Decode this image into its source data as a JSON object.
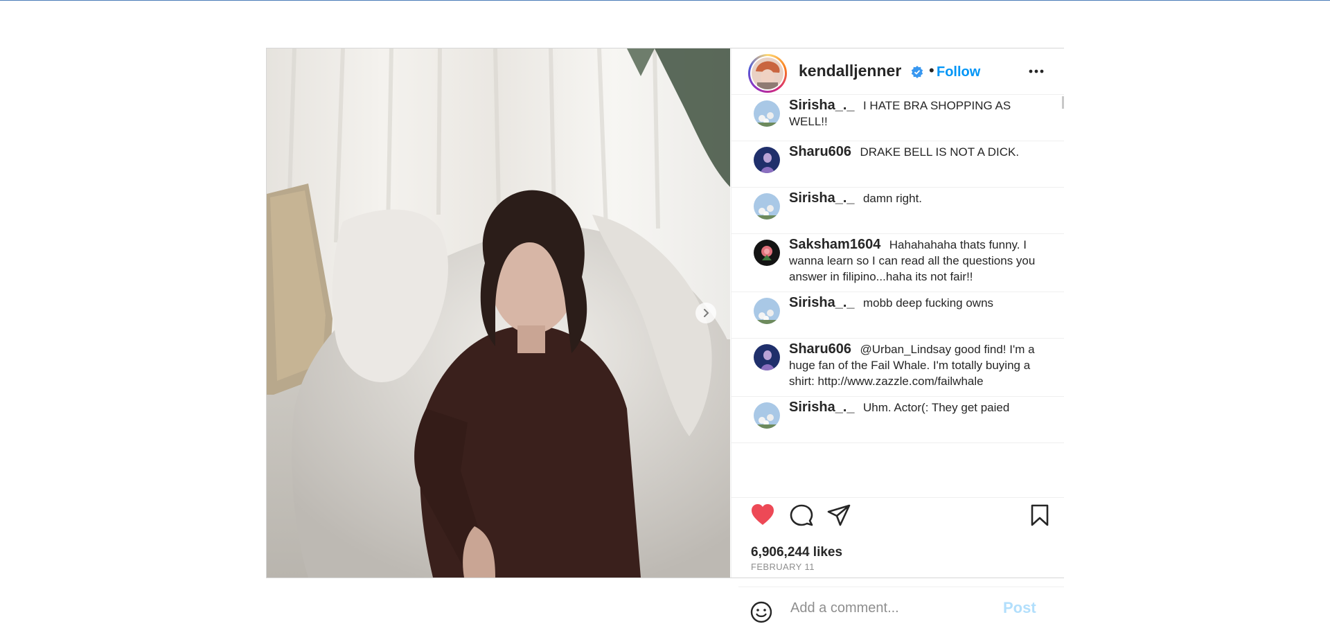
{
  "post": {
    "username": "kendalljenner",
    "separator": "•",
    "follow_label": "Follow",
    "verified_icon": "verified-badge-icon",
    "more_icon": "more-options-icon",
    "next_icon": "chevron-right-icon"
  },
  "comments": [
    {
      "user": "Sirisha_._",
      "text": "I HATE BRA SHOPPING AS WELL!!",
      "avatar": "floral-blue"
    },
    {
      "user": "Sharu606",
      "text": "DRAKE BELL IS NOT A DICK.",
      "avatar": "navy-figure"
    },
    {
      "user": "Sirisha_._",
      "text": "damn right.",
      "avatar": "floral-blue"
    },
    {
      "user": "Saksham1604",
      "text": "Hahahahaha thats funny. I wanna learn so I can read all the questions you answer in filipino...haha its not fair!!",
      "avatar": "rose-dark"
    },
    {
      "user": "Sirisha_._",
      "text": "mobb deep fucking owns",
      "avatar": "floral-blue"
    },
    {
      "user": "Sharu606",
      "text": "@Urban_Lindsay good find! I'm a huge fan of the Fail Whale. I'm totally buying a shirt: http://www.zazzle.com/failwhale",
      "avatar": "navy-figure"
    },
    {
      "user": "Sirisha_._",
      "text": "Uhm. Actor(: They get paied",
      "avatar": "floral-blue"
    }
  ],
  "actions": {
    "liked": true,
    "like_icon": "heart-filled-icon",
    "comment_icon": "comment-icon",
    "share_icon": "share-icon",
    "save_icon": "bookmark-icon",
    "like_color": "#ed4956"
  },
  "likes": "6,906,244 likes",
  "date": "FEBRUARY 11",
  "composer": {
    "placeholder": "Add a comment...",
    "post_label": "Post",
    "post_color": "#b2dffc",
    "emoji_icon": "smiley-icon"
  },
  "colors": {
    "accent": "#0095f6",
    "text": "#262626",
    "muted": "#8e8e8e"
  }
}
